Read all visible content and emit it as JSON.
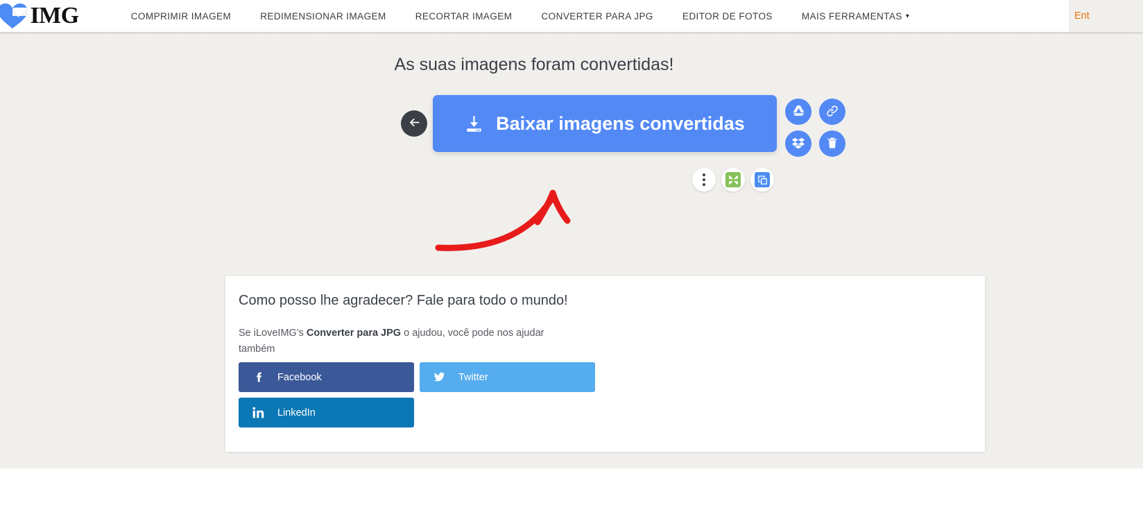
{
  "header": {
    "logo": {
      "prefix": "I",
      "suffix": "IMG",
      "heart_icon": "heart-icon"
    },
    "nav": [
      {
        "label": "COMPRIMIR IMAGEM"
      },
      {
        "label": "REDIMENSIONAR IMAGEM"
      },
      {
        "label": "RECORTAR IMAGEM"
      },
      {
        "label": "CONVERTER PARA JPG"
      },
      {
        "label": "EDITOR DE FOTOS"
      },
      {
        "label": "MAIS FERRAMENTAS",
        "caret": "▾"
      }
    ],
    "login_label": "Ent",
    "login_color": "#e8730d"
  },
  "main": {
    "headline": "As suas imagens foram convertidas!",
    "back_button_label": "",
    "download_button": {
      "label": "Baixar imagens convertidas",
      "color": "#5389f5"
    },
    "side_actions": [
      {
        "name": "google-drive",
        "label": ""
      },
      {
        "name": "copy-link",
        "label": ""
      },
      {
        "name": "dropbox",
        "label": ""
      },
      {
        "name": "delete",
        "label": ""
      }
    ],
    "sub_actions": [
      {
        "name": "more-options",
        "label": ""
      },
      {
        "name": "compress-image",
        "label": ""
      },
      {
        "name": "resize-image",
        "label": ""
      }
    ],
    "annotation": {
      "type": "red-arrow",
      "color": "#e81b1b"
    }
  },
  "card": {
    "title": "Como posso lhe agradecer? Fale para todo o mundo!",
    "sub_prefix": "Se iLoveIMG's ",
    "sub_bold": "Converter para JPG",
    "sub_suffix": " o ajudou, você pode nos ajudar também",
    "social": [
      {
        "label": "Facebook",
        "icon": "facebook-icon",
        "color": "#3b5998"
      },
      {
        "label": "Twitter",
        "icon": "twitter-icon",
        "color": "#55acee"
      },
      {
        "label": "LinkedIn",
        "icon": "linkedin-icon",
        "color": "#0b77b5"
      }
    ]
  },
  "colors": {
    "page_bg": "#f1efec",
    "accent": "#5389f5",
    "text": "#3a3f47"
  }
}
